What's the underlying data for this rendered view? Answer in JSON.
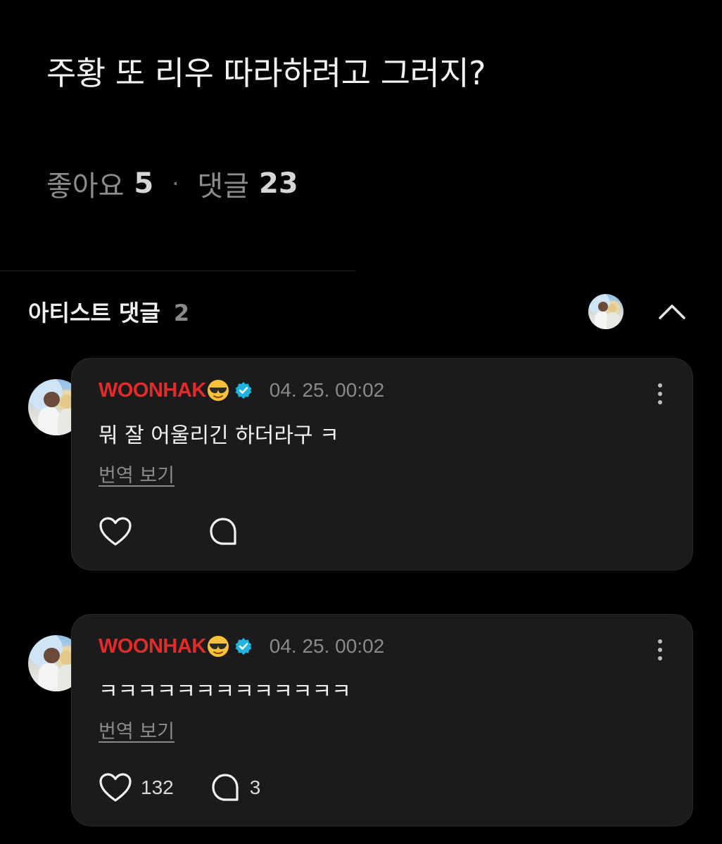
{
  "post": {
    "title": "주황 또 리우 따라하려고 그러지?",
    "likes_label": "좋아요",
    "likes_count": "5",
    "separator": "·",
    "comments_label": "댓글",
    "comments_count": "23"
  },
  "artist_comments": {
    "header_label": "아티스트 댓글",
    "count": "2",
    "collapse_icon": "chevron-up-icon",
    "items": [
      {
        "author": "WOONHAK",
        "author_emoji": "😎",
        "verified": true,
        "timestamp": "04. 25. 00:02",
        "text": "뭐 잘 어울리긴 하더라구 ㅋ",
        "translate_label": "번역 보기",
        "like_count": "",
        "reply_count": ""
      },
      {
        "author": "WOONHAK",
        "author_emoji": "😎",
        "verified": true,
        "timestamp": "04. 25. 00:02",
        "text": "ㅋㅋㅋㅋㅋㅋㅋㅋㅋㅋㅋㅋㅋ",
        "translate_label": "번역 보기",
        "like_count": "132",
        "reply_count": "3"
      }
    ]
  },
  "colors": {
    "background": "#000000",
    "card": "#1b1b1b",
    "author_name": "#e32b2b",
    "verified_badge": "#1fb3e0",
    "muted_text": "#8a8a8a"
  }
}
